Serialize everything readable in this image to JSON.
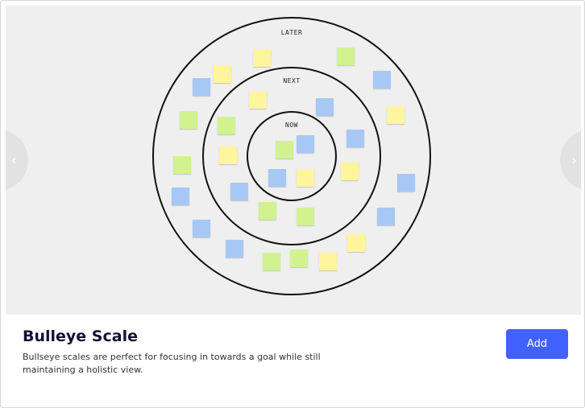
{
  "template": {
    "title": "Bulleye Scale",
    "description": "Bullseye scales are perfect for focusing in towards a goal while still maintaining a holistic view.",
    "add_label": "Add"
  },
  "navigation": {
    "prev_icon": "chevron-left-icon",
    "next_icon": "chevron-right-icon",
    "prev_glyph": "‹",
    "next_glyph": "›"
  },
  "rings": [
    {
      "label": "LATER"
    },
    {
      "label": "NEXT"
    },
    {
      "label": "NOW"
    }
  ],
  "colors": {
    "accent": "#4262ff",
    "sticky_yellow": "#fff59d",
    "sticky_green": "#d2f28f",
    "sticky_blue": "#a7c8f5",
    "preview_bg": "#efefef"
  },
  "sticky_notes": [
    {
      "color": "yellow"
    },
    {
      "color": "green"
    },
    {
      "color": "blue"
    },
    {
      "color": "yellow"
    },
    {
      "color": "blue"
    },
    {
      "color": "yellow"
    },
    {
      "color": "green"
    },
    {
      "color": "yellow"
    },
    {
      "color": "blue"
    },
    {
      "color": "green"
    },
    {
      "color": "blue"
    },
    {
      "color": "yellow"
    },
    {
      "color": "green"
    },
    {
      "color": "blue"
    },
    {
      "color": "green"
    },
    {
      "color": "blue"
    },
    {
      "color": "yellow"
    },
    {
      "color": "blue"
    },
    {
      "color": "yellow"
    },
    {
      "color": "blue"
    },
    {
      "color": "blue"
    },
    {
      "color": "blue"
    },
    {
      "color": "green"
    },
    {
      "color": "green"
    },
    {
      "color": "blue"
    },
    {
      "color": "blue"
    },
    {
      "color": "blue"
    },
    {
      "color": "yellow"
    },
    {
      "color": "green"
    },
    {
      "color": "green"
    },
    {
      "color": "yellow"
    },
    {
      "color": "green"
    },
    {
      "color": "yellow"
    },
    {
      "color": "blue"
    },
    {
      "color": "green"
    }
  ]
}
